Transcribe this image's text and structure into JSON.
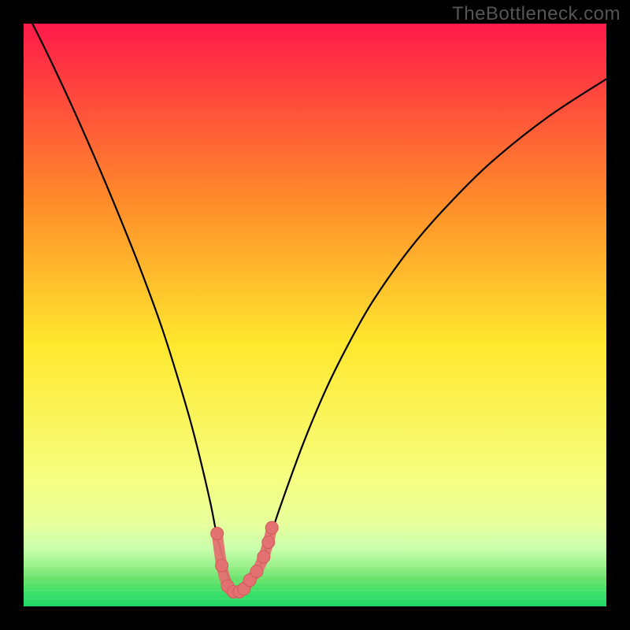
{
  "watermark": "TheBottleneck.com",
  "colors": {
    "top": "#ff1a4a",
    "mid_upper": "#ff8a2a",
    "mid": "#ffe82e",
    "mid_lower": "#f6ff80",
    "green_band_top": "#e6ff9c",
    "green_mid": "#66e26a",
    "green_bottom": "#1fd968",
    "curve": "#000000",
    "marker_fill": "#e37171",
    "marker_stroke": "#d25a5a"
  },
  "chart_data": {
    "type": "line",
    "title": "",
    "xlabel": "",
    "ylabel": "",
    "x_range": [
      0,
      100
    ],
    "y_range": [
      0,
      100
    ],
    "curve": {
      "x": [
        0,
        4,
        8,
        12,
        16,
        20,
        24,
        28,
        30,
        32,
        33,
        34,
        35,
        36,
        37,
        38,
        39,
        40,
        42,
        44,
        48,
        52,
        56,
        60,
        66,
        72,
        80,
        90,
        100
      ],
      "y": [
        103,
        95,
        86.5,
        77.5,
        68,
        58,
        47,
        34,
        26.5,
        18,
        13,
        9,
        5.5,
        3.5,
        2.5,
        2.5,
        3.5,
        5.5,
        11,
        17,
        28,
        37.5,
        45.5,
        52.5,
        61,
        68,
        76,
        84,
        90.5
      ]
    },
    "markers": {
      "x": [
        33.2,
        34.0,
        35.0,
        36.0,
        37.0,
        37.8,
        38.8,
        40.0,
        41.2,
        42.0,
        42.6
      ],
      "y": [
        12.5,
        7.0,
        3.5,
        2.5,
        2.5,
        3.0,
        4.5,
        6.0,
        8.5,
        11.0,
        13.5
      ]
    }
  }
}
